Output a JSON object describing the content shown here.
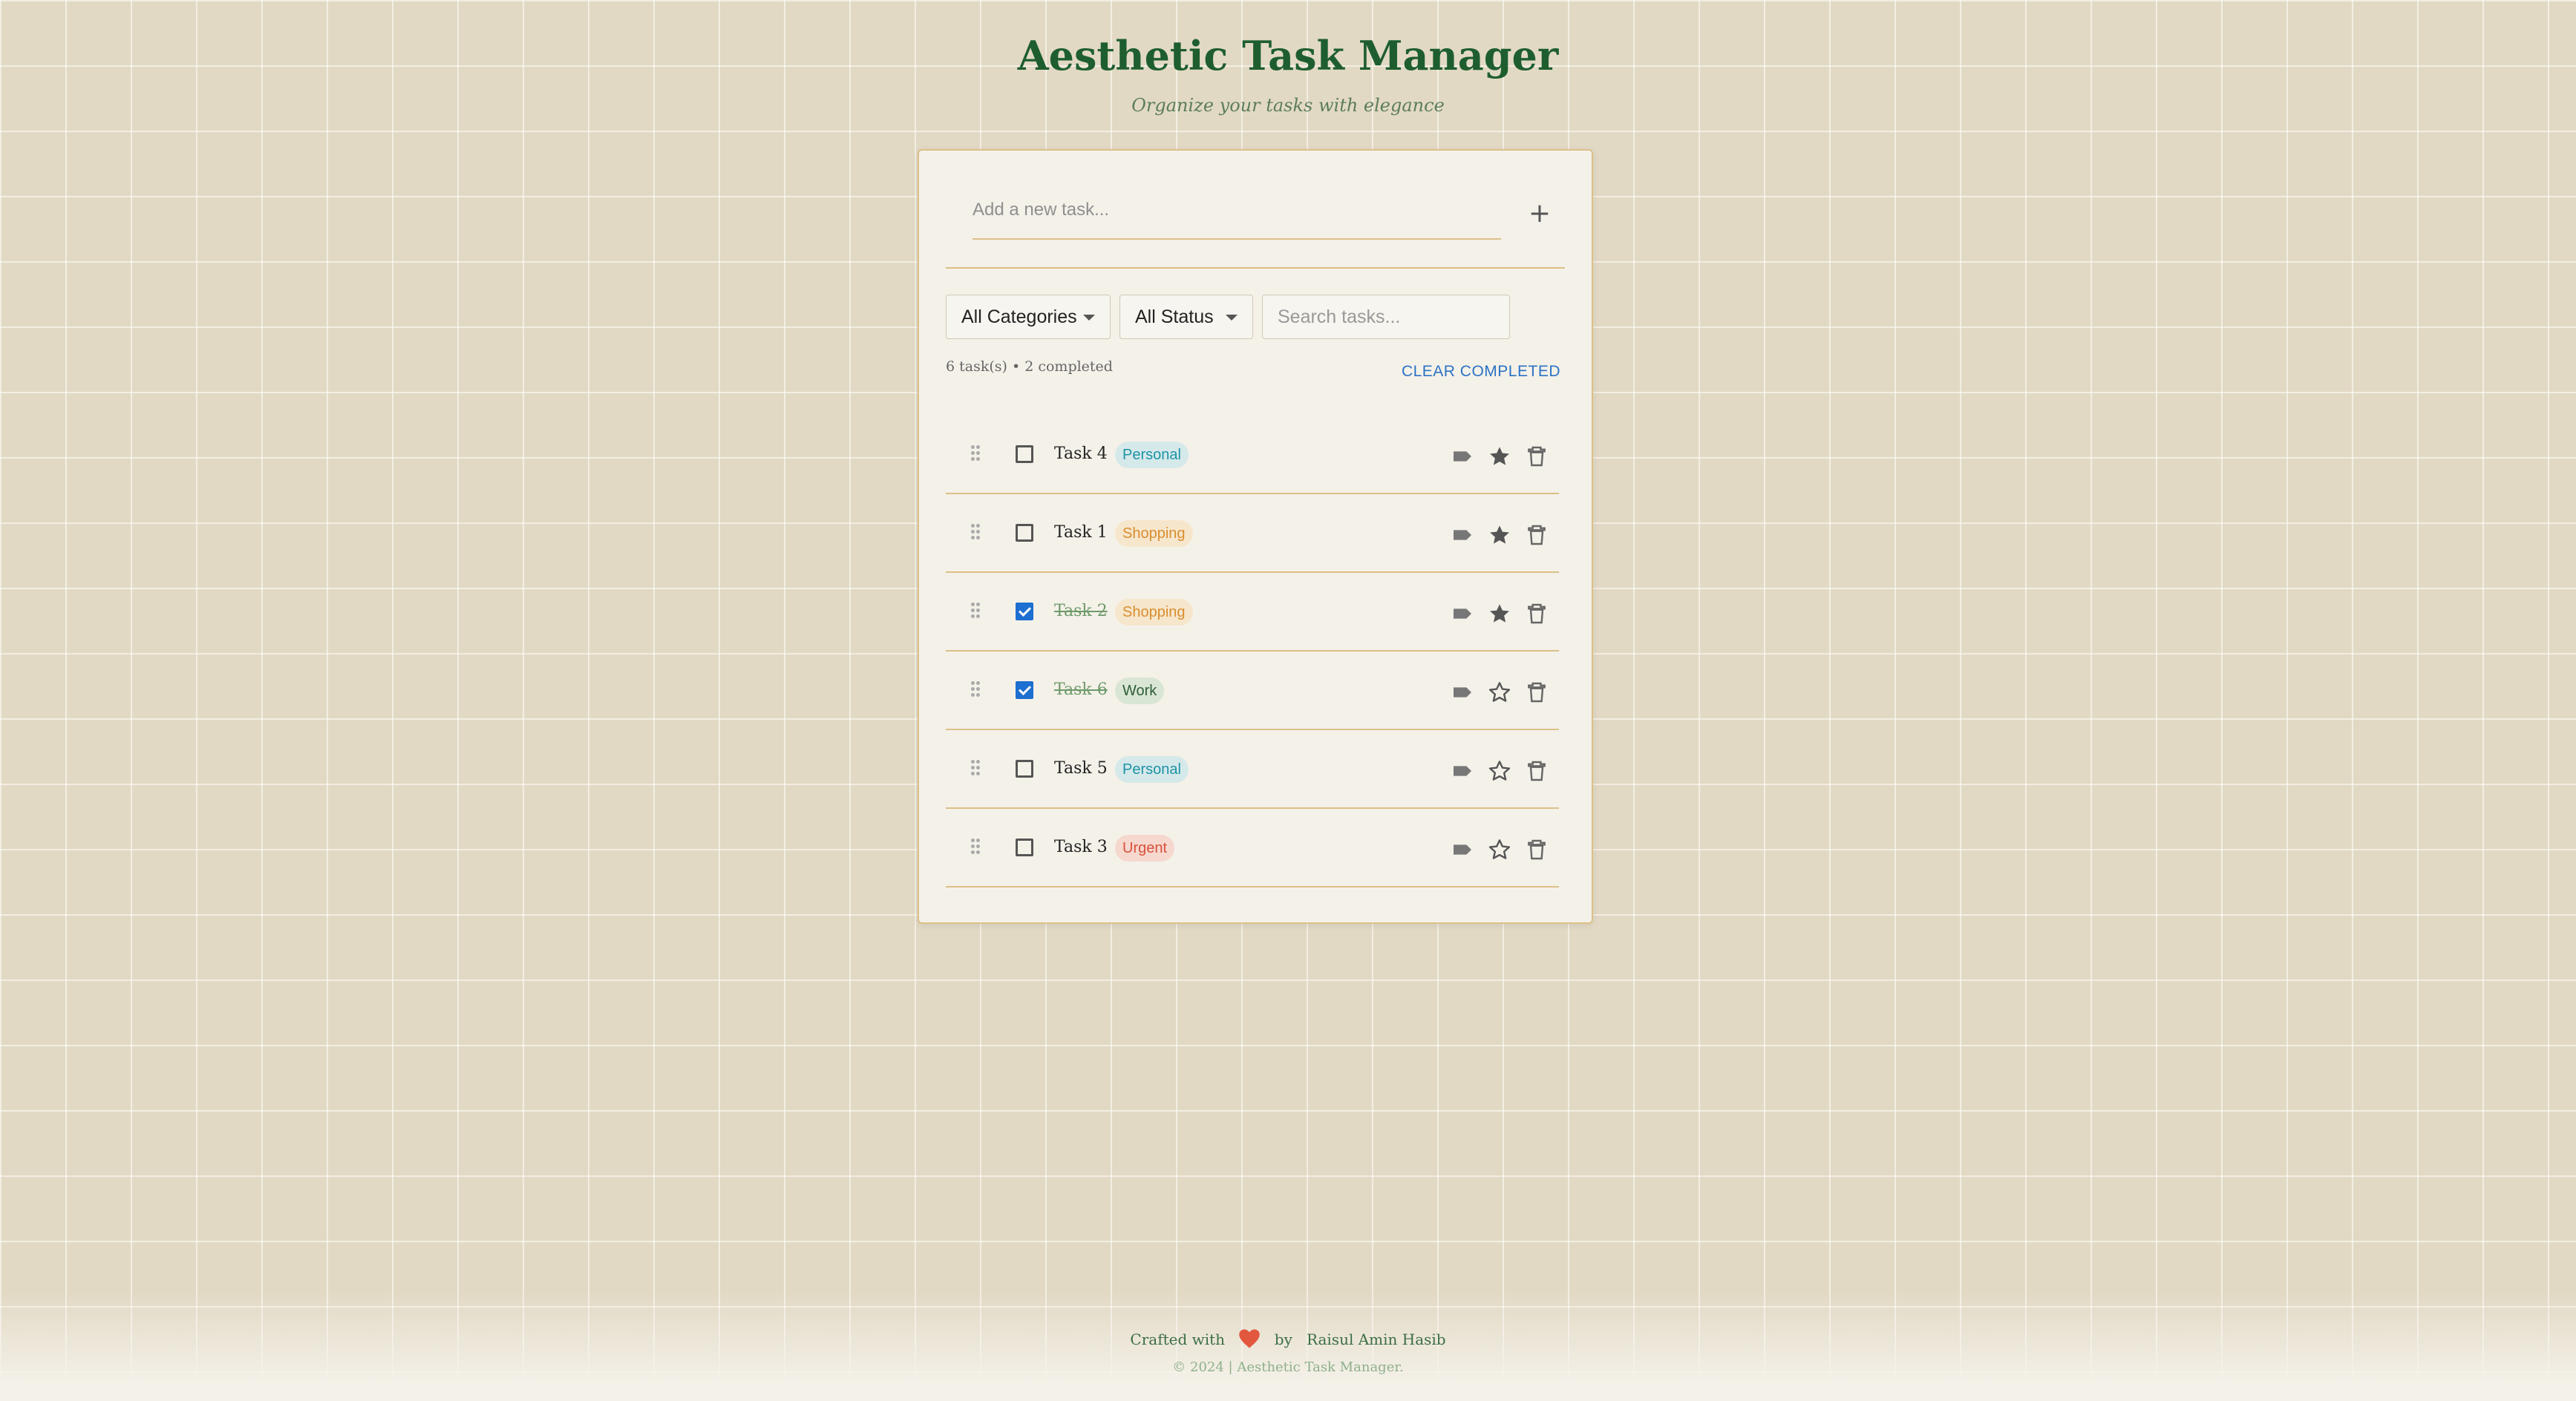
{
  "header": {
    "title": "Aesthetic Task Manager",
    "subtitle": "Organize your tasks with elegance"
  },
  "add_task": {
    "placeholder": "Add a new task...",
    "add_label": "+"
  },
  "filters": {
    "category_selected": "All Categories",
    "status_selected": "All Status",
    "search_placeholder": "Search tasks..."
  },
  "summary": {
    "counts_text": "6 task(s) • 2 completed",
    "clear_label": "CLEAR COMPLETED"
  },
  "tasks": [
    {
      "name": "Task 4",
      "tag": "Personal",
      "completed": false,
      "starred": true
    },
    {
      "name": "Task 1",
      "tag": "Shopping",
      "completed": false,
      "starred": true
    },
    {
      "name": "Task 2",
      "tag": "Shopping",
      "completed": true,
      "starred": true
    },
    {
      "name": "Task 6",
      "tag": "Work",
      "completed": true,
      "starred": false
    },
    {
      "name": "Task 5",
      "tag": "Personal",
      "completed": false,
      "starred": false
    },
    {
      "name": "Task 3",
      "tag": "Urgent",
      "completed": false,
      "starred": false
    }
  ],
  "icons": {
    "drag": "drag-handle-icon",
    "label": "label-icon",
    "star": "star-icon",
    "delete": "trash-icon",
    "heart": "heart-icon"
  },
  "colors": {
    "title": "#1e5e2e",
    "accent_border": "#dcc088",
    "checkbox_checked": "#1d6fd1",
    "clear_button": "#2b73c4",
    "heart": "#e2583e"
  },
  "footer": {
    "crafted_prefix": "Crafted with",
    "crafted_by": "by",
    "author": "Raisul Amin Hasib",
    "copyright": "© 2024 | Aesthetic Task Manager."
  }
}
